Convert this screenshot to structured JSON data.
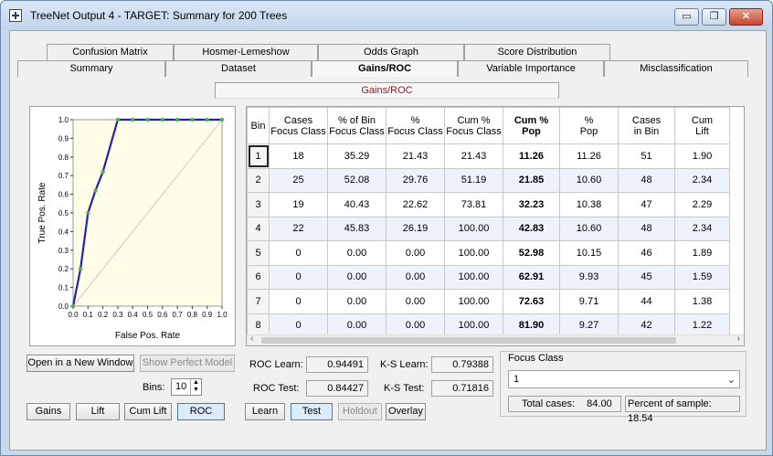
{
  "window": {
    "title": "TreeNet Output 4 - TARGET: Summary for 200 Trees",
    "minimize_glyph": "▭",
    "restore_glyph": "❐",
    "close_glyph": "✕"
  },
  "tabs_back": [
    "Confusion Matrix",
    "Hosmer-Lemeshow",
    "Odds Graph",
    "Score Distribution"
  ],
  "tabs_front": [
    "Summary",
    "Dataset",
    "Gains/ROC",
    "Variable Importance",
    "Misclassification"
  ],
  "active_tab": "Gains/ROC",
  "subtab_label": "Gains/ROC",
  "roc_plot": {
    "xlabel": "False Pos. Rate",
    "ylabel": "True Pos. Rate",
    "ticks": [
      "0.0",
      "0.1",
      "0.2",
      "0.3",
      "0.4",
      "0.5",
      "0.6",
      "0.7",
      "0.8",
      "0.9",
      "1.0"
    ],
    "curve_color": "#2323a8",
    "point_color": "#4caf50",
    "background": "#fffde8"
  },
  "chart_data": {
    "type": "line",
    "xlabel": "False Pos. Rate",
    "ylabel": "True Pos. Rate",
    "xlim": [
      0,
      1
    ],
    "ylim": [
      0,
      1
    ],
    "x": [
      0.0,
      0.05,
      0.1,
      0.15,
      0.2,
      0.3,
      0.4,
      0.5,
      0.6,
      0.7,
      0.8,
      0.9,
      1.0
    ],
    "y": [
      0.0,
      0.2,
      0.5,
      0.62,
      0.72,
      1.0,
      1.0,
      1.0,
      1.0,
      1.0,
      1.0,
      1.0,
      1.0
    ],
    "diagonal": true
  },
  "table": {
    "headers": [
      [
        "Bin"
      ],
      [
        "Cases",
        "Focus Class"
      ],
      [
        "% of Bin",
        "Focus Class"
      ],
      [
        "%",
        "Focus Class"
      ],
      [
        "Cum %",
        "Focus Class"
      ],
      [
        "Cum %",
        "Pop"
      ],
      [
        "%",
        "Pop"
      ],
      [
        "Cases",
        "in Bin"
      ],
      [
        "Cum",
        "Lift"
      ]
    ],
    "rows": [
      [
        "1",
        "18",
        "35.29",
        "21.43",
        "21.43",
        "11.26",
        "11.26",
        "51",
        "1.90"
      ],
      [
        "2",
        "25",
        "52.08",
        "29.76",
        "51.19",
        "21.85",
        "10.60",
        "48",
        "2.34"
      ],
      [
        "3",
        "19",
        "40.43",
        "22.62",
        "73.81",
        "32.23",
        "10.38",
        "47",
        "2.29"
      ],
      [
        "4",
        "22",
        "45.83",
        "26.19",
        "100.00",
        "42.83",
        "10.60",
        "48",
        "2.34"
      ],
      [
        "5",
        "0",
        "0.00",
        "0.00",
        "100.00",
        "52.98",
        "10.15",
        "46",
        "1.89"
      ],
      [
        "6",
        "0",
        "0.00",
        "0.00",
        "100.00",
        "62.91",
        "9.93",
        "45",
        "1.59"
      ],
      [
        "7",
        "0",
        "0.00",
        "0.00",
        "100.00",
        "72.63",
        "9.71",
        "44",
        "1.38"
      ],
      [
        "8",
        "0",
        "0.00",
        "0.00",
        "100.00",
        "81.90",
        "9.27",
        "42",
        "1.22"
      ]
    ]
  },
  "buttons": {
    "open_new_window": "Open in a New Window",
    "show_perfect_model": "Show Perfect Model",
    "gains": "Gains",
    "lift": "Lift",
    "cum_lift": "Cum Lift",
    "roc": "ROC",
    "learn": "Learn",
    "test": "Test",
    "holdout": "Holdout",
    "overlay": "Overlay"
  },
  "bins": {
    "label": "Bins:",
    "value": "10"
  },
  "stats": {
    "roc_learn_label": "ROC Learn:",
    "roc_learn": "0.94491",
    "roc_test_label": "ROC Test:",
    "roc_test": "0.84427",
    "ks_learn_label": "K-S Learn:",
    "ks_learn": "0.79388",
    "ks_test_label": "K-S Test:",
    "ks_test": "0.71816"
  },
  "focus_class": {
    "label": "Focus Class",
    "value": "1",
    "total_cases_label": "Total cases:",
    "total_cases": "84.00",
    "percent_label": "Percent of sample:",
    "percent": "18.54"
  }
}
